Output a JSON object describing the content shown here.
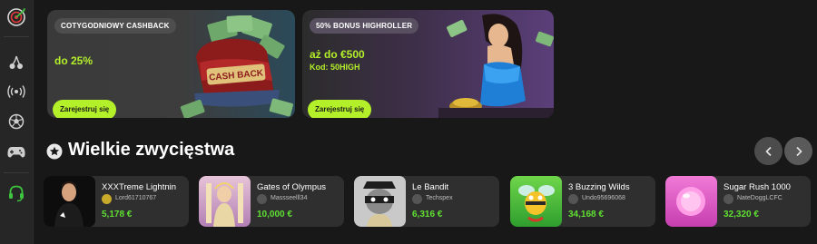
{
  "sidebar": {
    "items": [
      {
        "icon": "dart-icon",
        "active": true
      },
      {
        "icon": "cherries-icon"
      },
      {
        "icon": "live-broadcast-icon"
      },
      {
        "icon": "football-icon"
      },
      {
        "icon": "gamepad-icon"
      },
      {
        "icon": "headset-support-icon"
      }
    ]
  },
  "promos": [
    {
      "badge": "COTYGODNIOWY CASHBACK",
      "headline": "do 25%",
      "button": "Zarejestruj się",
      "art": "cash-back-suitcase-icon"
    },
    {
      "badge": "50% BONUS HIGHROLLER",
      "headline": "aż do €500",
      "code": "Kod: 50HIGH",
      "button": "Zarejestruj się",
      "art": "highroller-woman-image"
    }
  ],
  "section": {
    "title": "Wielkie zwycięstwa",
    "icon": "star-icon",
    "prev_icon": "chevron-left-icon",
    "next_icon": "chevron-right-icon"
  },
  "wins": [
    {
      "game": "XXXTreme Lightnin",
      "user": "Lord61710767",
      "amount": "5,178 €"
    },
    {
      "game": "Gates of Olympus",
      "user": "Massseelll34",
      "amount": "10,000 €"
    },
    {
      "game": "Le Bandit",
      "user": "Techspex",
      "amount": "6,316 €"
    },
    {
      "game": "3 Buzzing Wilds",
      "user": "Undo95696068",
      "amount": "34,168 €"
    },
    {
      "game": "Sugar Rush 1000",
      "user": "NateDoggLCFC",
      "amount": "32,320 €"
    }
  ],
  "colors": {
    "accent": "#b4f02a",
    "win_amount": "#5fe032",
    "background": "#181818",
    "card": "#2f2f2f"
  }
}
